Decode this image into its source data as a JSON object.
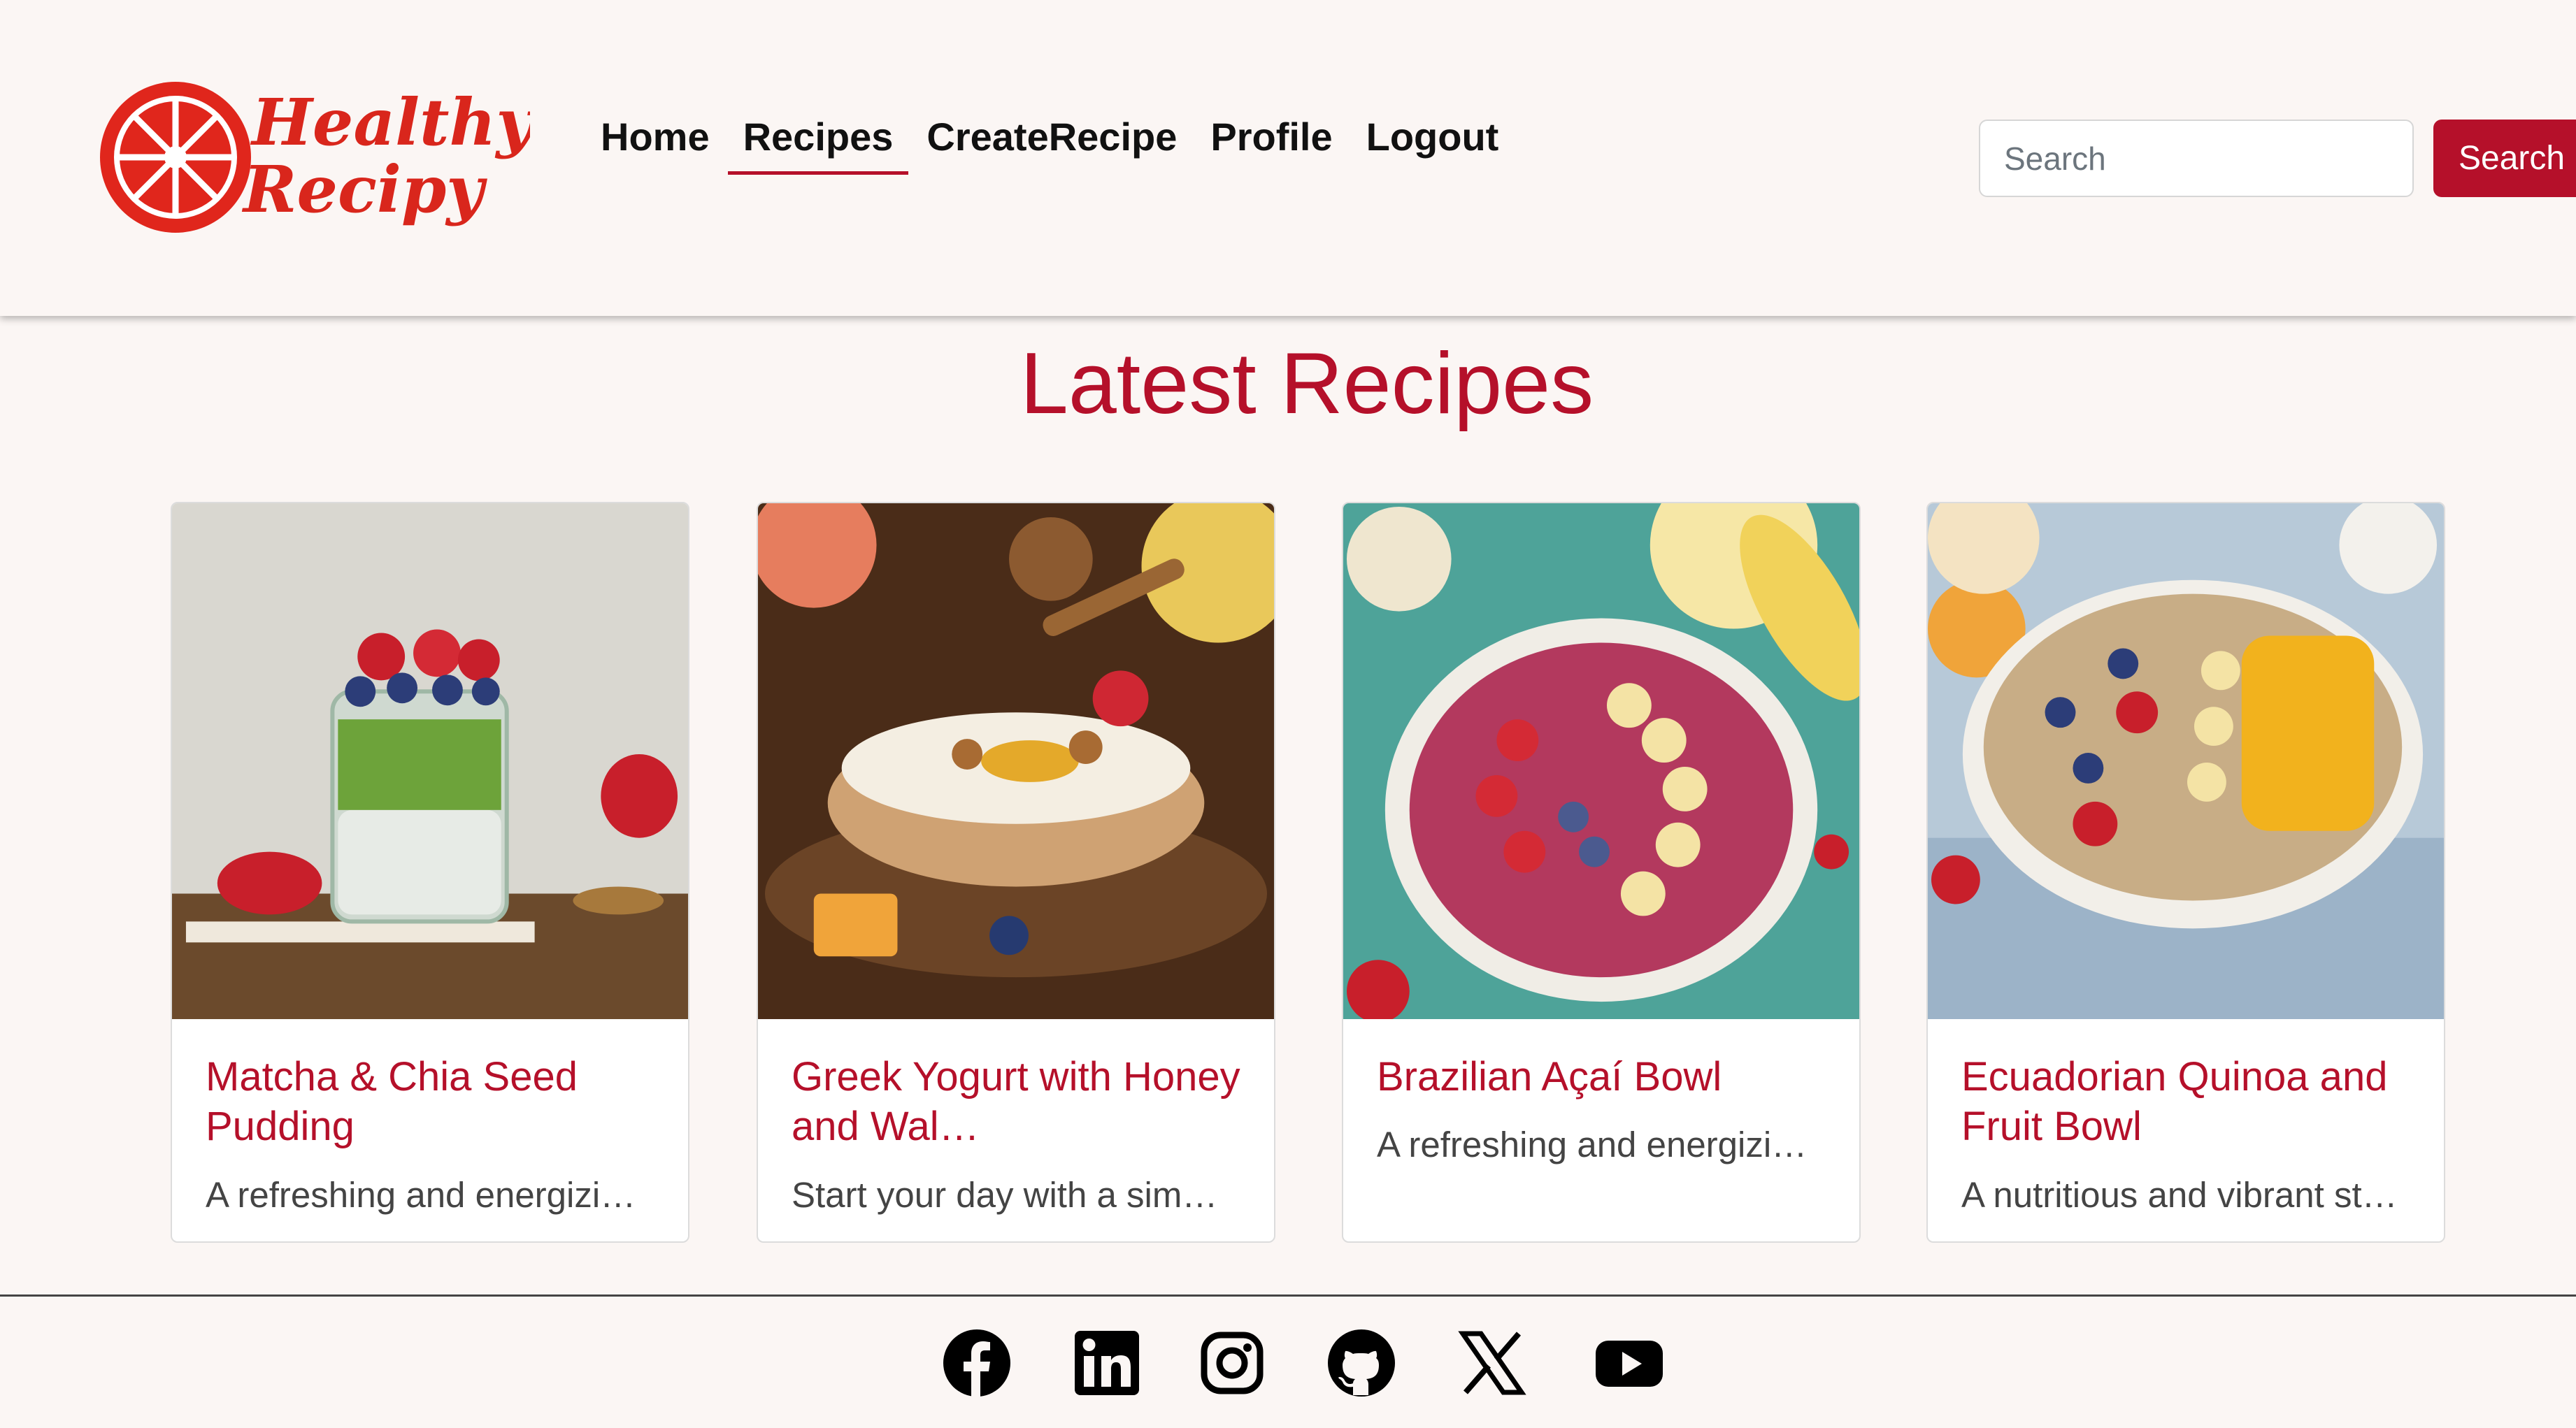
{
  "brand": {
    "line1": "Healthy",
    "line2": "Recipy",
    "color": "#d9261c"
  },
  "nav": {
    "items": [
      {
        "label": "Home"
      },
      {
        "label": "Recipes",
        "active": true
      },
      {
        "label": "CreateRecipe"
      },
      {
        "label": "Profile"
      },
      {
        "label": "Logout"
      }
    ]
  },
  "search": {
    "placeholder": "Search",
    "value": "",
    "button_label": "Search"
  },
  "section": {
    "title": "Latest Recipes"
  },
  "recipes": [
    {
      "title": "Matcha & Chia Seed Pudding",
      "description": "A refreshing and energizi…",
      "image": "matcha-chia-pudding-jar"
    },
    {
      "title": "Greek Yogurt with Honey and Wal…",
      "description": "Start your day with a sim…",
      "image": "greek-yogurt-honey-bowl"
    },
    {
      "title": "Brazilian Açaí Bowl",
      "description": "A refreshing and energizi…",
      "image": "acai-bowl"
    },
    {
      "title": "Ecuadorian Quinoa and Fruit Bowl",
      "description": "A nutritious and vibrant st…",
      "image": "quinoa-fruit-bowl"
    }
  ],
  "footer": {
    "social": [
      {
        "icon": "facebook-icon"
      },
      {
        "icon": "linkedin-icon"
      },
      {
        "icon": "instagram-icon"
      },
      {
        "icon": "github-icon"
      },
      {
        "icon": "x-icon"
      },
      {
        "icon": "youtube-icon"
      }
    ]
  },
  "colors": {
    "accent": "#b5102a",
    "background": "#fbf6f4",
    "text": "#111111"
  }
}
